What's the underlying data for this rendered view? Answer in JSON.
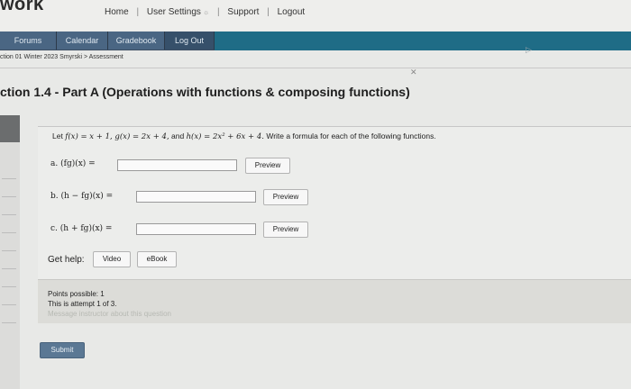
{
  "brand": "work",
  "top_nav": {
    "home": "Home",
    "user_settings": "User Settings",
    "support": "Support",
    "logout": "Logout",
    "separator": "|"
  },
  "tabs": [
    {
      "label": "Forums"
    },
    {
      "label": "Calendar"
    },
    {
      "label": "Gradebook"
    },
    {
      "label": "Log Out"
    }
  ],
  "breadcrumb": "ction 01 Winter 2023 Smyrski > Assessment",
  "page_title": "ction 1.4 - Part A (Operations with functions & composing functions)",
  "question": {
    "prompt_prefix": "Let ",
    "prompt_math": "f(x) = x + 1, g(x) = 2x + 4,",
    "prompt_mid": " and ",
    "prompt_math2": "h(x) = 2x² + 6x + 4.",
    "prompt_suffix": " Write a formula for each of the following functions.",
    "parts": [
      {
        "label": "a.",
        "expr": "(fg)(x) ="
      },
      {
        "label": "b.",
        "expr": "(h − fg)(x) ="
      },
      {
        "label": "c.",
        "expr": "(h + fg)(x) ="
      }
    ],
    "preview_label": "Preview",
    "get_help": "Get help:",
    "video_label": "Video",
    "ebook_label": "eBook"
  },
  "info": {
    "points": "Points possible: 1",
    "attempt": "This is attempt 1 of 3.",
    "message": "Message instructor about this question"
  },
  "submit_label": "Submit"
}
